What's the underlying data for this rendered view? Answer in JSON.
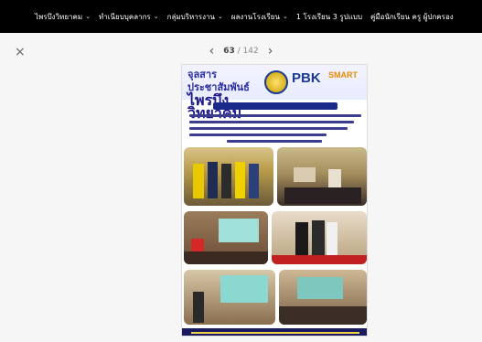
{
  "nav": {
    "items": [
      {
        "label": "ไพรบึงวิทยาคม",
        "has_dropdown": true
      },
      {
        "label": "ทำเนียบบุคลากร",
        "has_dropdown": true
      },
      {
        "label": "กลุ่มบริหารงาน",
        "has_dropdown": true
      },
      {
        "label": "ผลงานโรงเรียน",
        "has_dropdown": true
      },
      {
        "label": "1 โรงเรียน 3 รูปแบบ",
        "has_dropdown": false
      },
      {
        "label": "คู่มือนักเรียน ครู ผู้ปกครอง",
        "has_dropdown": false
      }
    ],
    "chevron": "⌄"
  },
  "viewer": {
    "close_icon": "×",
    "prev_icon": "‹",
    "next_icon": "›",
    "current_page": "63",
    "separator": "/",
    "total_pages": "142"
  },
  "poster": {
    "title_line1": "จุลสารประชาสัมพันธ์",
    "title_line2": "ไพรบึงวิทยาคม",
    "brand": "PBK",
    "brand_tag": "SMART"
  },
  "colors": {
    "nav_bg": "#000000",
    "nav_text": "#ffffff",
    "viewer_bg": "#f6f6f6",
    "poster_blue": "#1b3a91",
    "accent_orange": "#e88a00"
  }
}
